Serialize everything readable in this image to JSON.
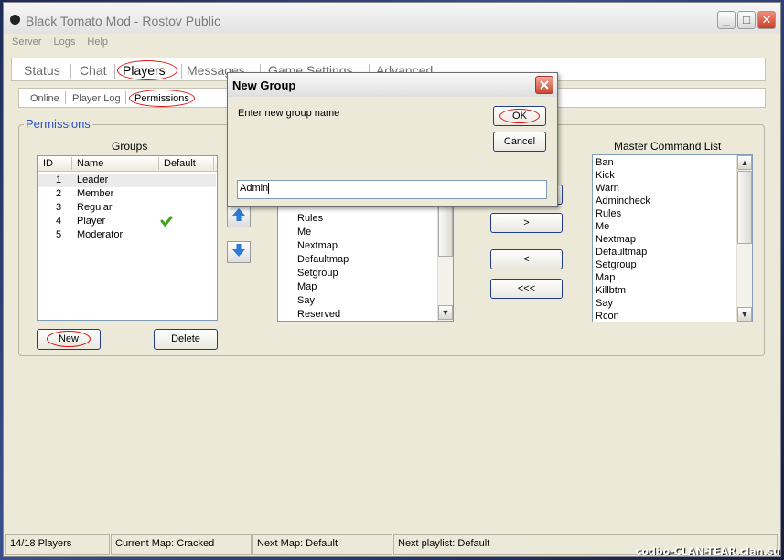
{
  "window": {
    "title": "Black Tomato Mod - Rostov Public",
    "controls": {
      "minimize": "_",
      "maximize": "□",
      "close": "✕"
    }
  },
  "menu": [
    "Server",
    "Logs",
    "Help"
  ],
  "tabs": [
    "Status",
    "Chat",
    "Players",
    "Messages",
    "Game Settings",
    "Advanced"
  ],
  "subtabs": [
    "Online",
    "Player Log",
    "Permissions"
  ],
  "permissions": {
    "title": "Permissions",
    "groups": {
      "title": "Groups",
      "columns": [
        "ID",
        "Name",
        "Default"
      ],
      "rows": [
        {
          "id": "1",
          "name": "Leader",
          "default": false
        },
        {
          "id": "2",
          "name": "Member",
          "default": false
        },
        {
          "id": "3",
          "name": "Regular",
          "default": false
        },
        {
          "id": "4",
          "name": "Player",
          "default": true
        },
        {
          "id": "5",
          "name": "Moderator",
          "default": false
        }
      ],
      "new_label": "New",
      "delete_label": "Delete"
    },
    "group_commands": [
      "Rules",
      "Me",
      "Nextmap",
      "Defaultmap",
      "Setgroup",
      "Map",
      "Say",
      "Reserved"
    ],
    "transfer_buttons": [
      ">",
      "<",
      "<<<"
    ],
    "master": {
      "title": "Master Command List",
      "items": [
        "Ban",
        "Kick",
        "Warn",
        "Admincheck",
        "Rules",
        "Me",
        "Nextmap",
        "Defaultmap",
        "Setgroup",
        "Map",
        "Killbtm",
        "Say",
        "Rcon"
      ]
    }
  },
  "dialog": {
    "title": "New Group",
    "prompt": "Enter new group name",
    "ok_label": "OK",
    "cancel_label": "Cancel",
    "input_value": "Admin"
  },
  "statusbar": {
    "players": "14/18 Players",
    "current_map": "Current Map: Cracked",
    "next_map": "Next Map: Default",
    "next_playlist": "Next playlist: Default"
  },
  "watermark": "codbo-CLAN-TEAR.clan.su",
  "colors": {
    "accent": "#2a52c2",
    "highlight_oval": "#dd1111",
    "check": "#3ea31a"
  }
}
